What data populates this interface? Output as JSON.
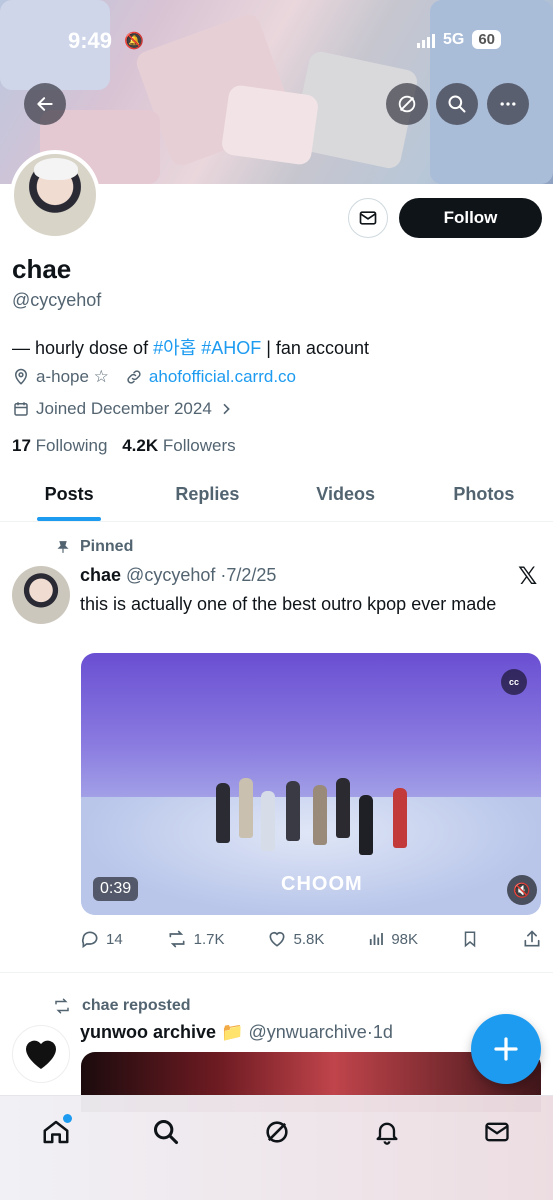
{
  "status_bar": {
    "time": "9:49",
    "network": "5G",
    "battery": "60"
  },
  "profile": {
    "display_name": "chae",
    "handle": "@cycyehof",
    "bio_prefix": "— hourly dose of ",
    "bio_tag1": "#아홉",
    "bio_tag2": " #AHOF",
    "bio_suffix": " | fan account",
    "location": "a-hope ☆",
    "website": "ahofofficial.carrd.co",
    "joined": "Joined December 2024",
    "following_count": "17",
    "following_label": "Following",
    "followers_count": "4.2K",
    "followers_label": "Followers",
    "follow_label": "Follow"
  },
  "tabs": [
    {
      "label": "Posts",
      "active": true
    },
    {
      "label": "Replies",
      "active": false
    },
    {
      "label": "Videos",
      "active": false
    },
    {
      "label": "Photos",
      "active": false
    }
  ],
  "pinned_post": {
    "pinned_label": "Pinned",
    "author": "chae",
    "handle": "@cycyehof",
    "date": "7/2/25",
    "text": "this is actually one of the best outro kpop ever made",
    "video_duration": "0:39",
    "video_watermark": "CHOOM",
    "cc_label": "cc",
    "replies": "14",
    "reposts": "1.7K",
    "likes": "5.8K",
    "views": "98K"
  },
  "repost": {
    "reposted_label": "chae reposted",
    "author": "yunwoo archive",
    "author_emoji": "📁",
    "handle": "@ynwuarchive",
    "time": "1d"
  },
  "colors": {
    "accent": "#1d9bf0",
    "text": "#0f1419",
    "muted": "#536471"
  }
}
